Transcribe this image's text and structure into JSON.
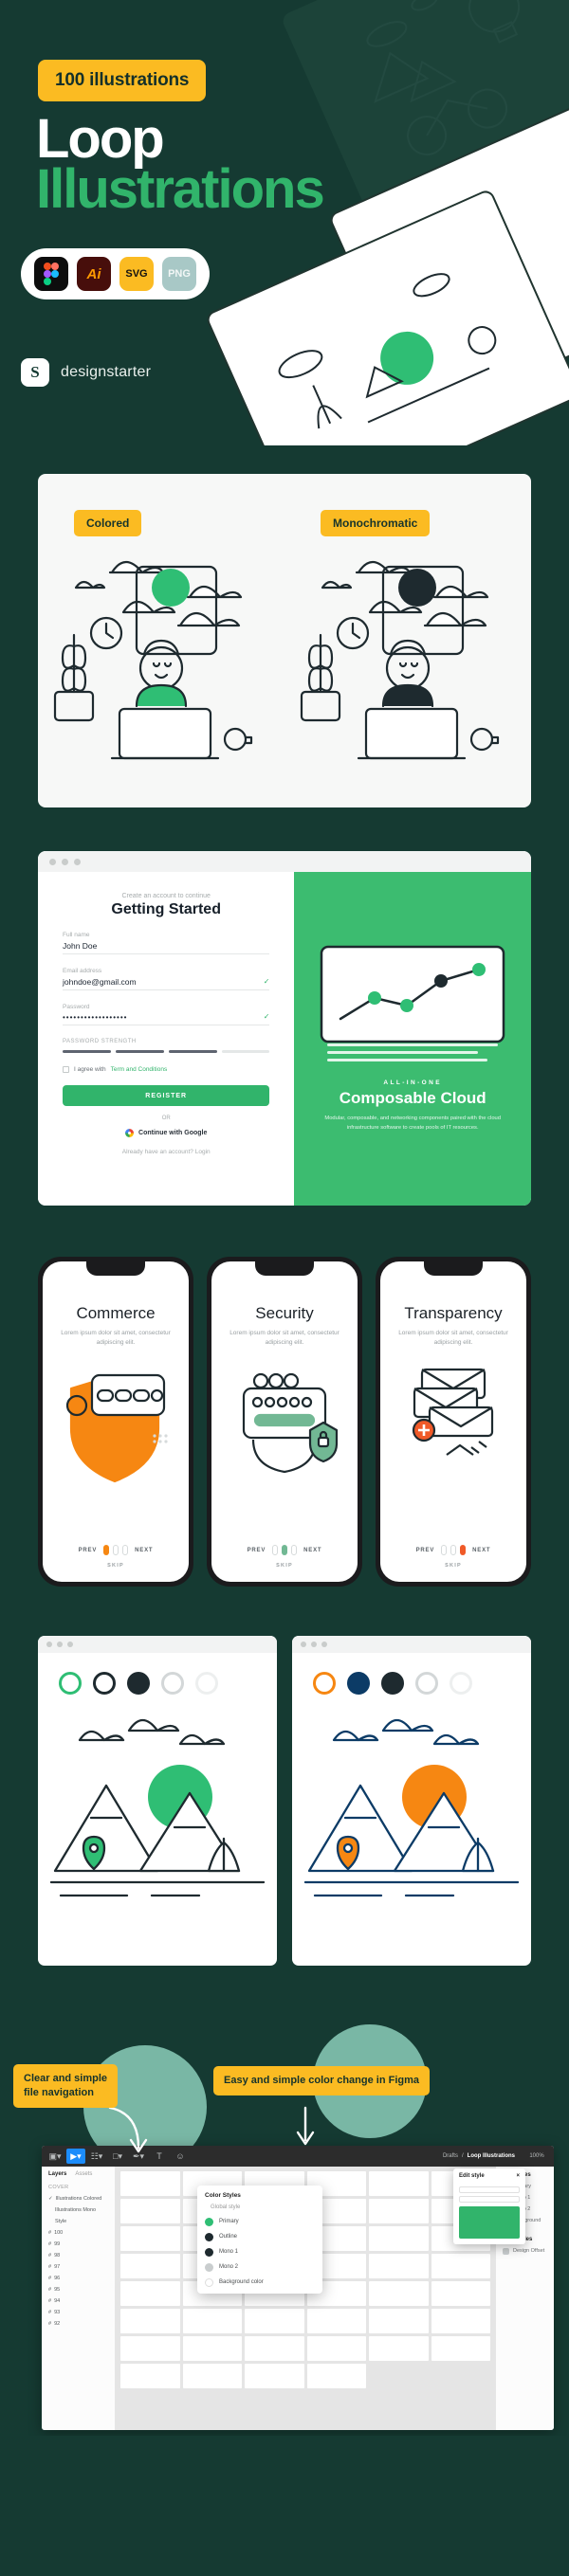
{
  "hero": {
    "badge": "100 illustrations",
    "title_line1": "Loop",
    "title_line2": "Illustrations",
    "formats": [
      {
        "name": "Figma",
        "label": ""
      },
      {
        "name": "Adobe Illustrator",
        "label": "Ai"
      },
      {
        "name": "SVG",
        "label": "SVG"
      },
      {
        "name": "PNG",
        "label": "PNG"
      }
    ],
    "brand_mark": "S",
    "brand_name": "designstarter"
  },
  "compare": {
    "tag_left": "Colored",
    "tag_right": "Monochromatic"
  },
  "web": {
    "signup": {
      "subtitle": "Create an account to continue",
      "title": "Getting Started",
      "fields": [
        {
          "label": "Full name",
          "value": "John Doe",
          "check": ""
        },
        {
          "label": "Email address",
          "value": "johndoe@gmail.com",
          "check": "✓"
        },
        {
          "label": "Password",
          "value": "••••••••••••••••••",
          "check": "✓"
        }
      ],
      "strength_label": "PASSWORD STRENGTH",
      "agree_prefix": "I agree with ",
      "agree_link": "Term and Conditions",
      "register": "REGISTER",
      "or": "OR",
      "google": "Continue with Google",
      "already": "Already have an account? Login"
    },
    "promo": {
      "eyebrow": "ALL-IN-ONE",
      "title": "Composable Cloud",
      "desc": "Modular, composable, and networking components paired with the cloud infrastructure software to create pools of IT resources."
    }
  },
  "phones": [
    {
      "title": "Commerce",
      "sub": "Lorem ipsum dolor sit amet, consectetur adipiscing elit.",
      "accent": "#F68712",
      "prev": "PREV",
      "next": "NEXT",
      "skip": "SKIP",
      "active_page": 0
    },
    {
      "title": "Security",
      "sub": "Lorem ipsum dolor sit amet, consectetur adipiscing elit.",
      "accent": "#72B894",
      "prev": "PREV",
      "next": "NEXT",
      "skip": "SKIP",
      "active_page": 1
    },
    {
      "title": "Transparency",
      "sub": "Lorem ipsum dolor sit amet, consectetur adipiscing elit.",
      "accent": "#F05A28",
      "prev": "PREV",
      "next": "NEXT",
      "skip": "SKIP",
      "active_page": 2
    }
  ],
  "mountains": [
    {
      "swatches": [
        "#2FBE74",
        "#1E2A2F",
        "#1E2A2F",
        "#D3D7D8",
        "#FFFFFF"
      ],
      "accent": "#2FBE74"
    },
    {
      "swatches": [
        "#F68712",
        "#0C3B66",
        "#1E2A2F",
        "#D3D7D8",
        "#FFFFFF"
      ],
      "accent": "#F68712"
    }
  ],
  "figma": {
    "tag_left": "Clear and simple\nfile navigation",
    "tag_left_line1": "Clear and simple",
    "tag_left_line2": "file navigation",
    "tag_right": "Easy and simple color change in Figma",
    "toolbar": [
      "components-icon",
      "move-tool-icon",
      "frame-tool-icon",
      "shape-tool-icon",
      "pen-tool-icon",
      "text-tool-icon",
      "comment-icon"
    ],
    "layers": {
      "tabs": [
        "Layers",
        "Assets"
      ],
      "active_tab": "Layers",
      "items": [
        {
          "label": "COVER",
          "kind": "head"
        },
        {
          "label": "Illustrations Colored",
          "kind": "page",
          "checked": true
        },
        {
          "label": "Illustrations Mono",
          "kind": "page"
        },
        {
          "label": "Style",
          "kind": "page"
        },
        {
          "label": "100",
          "kind": "frame"
        },
        {
          "label": "99",
          "kind": "frame"
        },
        {
          "label": "98",
          "kind": "frame"
        },
        {
          "label": "97",
          "kind": "frame"
        },
        {
          "label": "96",
          "kind": "frame"
        },
        {
          "label": "95",
          "kind": "frame"
        },
        {
          "label": "94",
          "kind": "frame"
        },
        {
          "label": "93",
          "kind": "frame"
        },
        {
          "label": "92",
          "kind": "frame"
        }
      ]
    },
    "color_styles": {
      "title": "Color Styles",
      "group": "Global style",
      "items": [
        {
          "name": "Primary",
          "color": "#2FBE74"
        },
        {
          "name": "Outline",
          "color": "#1E2A2F"
        },
        {
          "name": "Mono 1",
          "color": "#1E2A2F"
        },
        {
          "name": "Mono 2",
          "color": "#C9CDCE"
        },
        {
          "name": "Background color",
          "color": "#FFFFFF"
        }
      ]
    },
    "breadcrumb": {
      "drafts": "Drafts",
      "sep": "/",
      "file": "Loop Illustrations"
    },
    "right_panel": {
      "edit_title": "Edit style",
      "close": "×",
      "properties_title": "Properties",
      "rows": [
        {
          "label": "Primary"
        },
        {
          "label": "Mono 1"
        },
        {
          "label": "Mono 2"
        },
        {
          "label": "Background color"
        }
      ],
      "size_title": "Size Styles",
      "size_rows": [
        {
          "label": "Design Offset"
        }
      ],
      "zoom": "100%"
    }
  },
  "colors": {
    "bg_dark": "#153A32",
    "green": "#31B46B",
    "yellow": "#FBBB22",
    "white": "#FFFFFF",
    "orange": "#F68712"
  }
}
